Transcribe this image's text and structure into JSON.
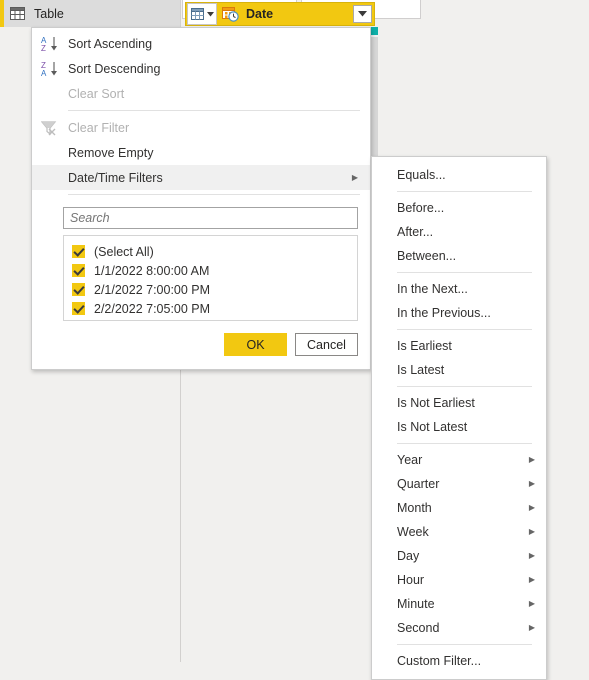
{
  "workspace": {
    "table_tab_label": "Table",
    "accent_color": "#f2c811",
    "background_color": "#f1f0ee",
    "quality_bar_color": "#0fb0a9"
  },
  "column_header": {
    "name": "Date",
    "type_icon": "datetime-icon",
    "table_icon": "table-icon",
    "dropdown_icon": "chevron-down-icon",
    "background_color": "#f2c811"
  },
  "context_menu": {
    "items": [
      {
        "label": "Sort Ascending",
        "icon": "sort-ascending-icon",
        "disabled": false,
        "submenu": false,
        "highlighted": false
      },
      {
        "label": "Sort Descending",
        "icon": "sort-descending-icon",
        "disabled": false,
        "submenu": false,
        "highlighted": false
      },
      {
        "label": "Clear Sort",
        "icon": "",
        "disabled": true,
        "submenu": false,
        "highlighted": false
      },
      {
        "label": "Clear Filter",
        "icon": "clear-filter-icon",
        "disabled": true,
        "submenu": false,
        "highlighted": false
      },
      {
        "label": "Remove Empty",
        "icon": "",
        "disabled": false,
        "submenu": false,
        "highlighted": false
      },
      {
        "label": "Date/Time Filters",
        "icon": "",
        "disabled": false,
        "submenu": true,
        "highlighted": true
      }
    ],
    "search": {
      "placeholder": "Search",
      "value": ""
    },
    "values": [
      {
        "label": "(Select All)",
        "checked": true
      },
      {
        "label": "1/1/2022 8:00:00 AM",
        "checked": true
      },
      {
        "label": "2/1/2022 7:00:00 PM",
        "checked": true
      },
      {
        "label": "2/2/2022 7:05:00 PM",
        "checked": true
      }
    ],
    "buttons": {
      "ok": "OK",
      "cancel": "Cancel"
    }
  },
  "submenu": {
    "items": [
      {
        "label": "Equals...",
        "submenu": false,
        "sep_after": true
      },
      {
        "label": "Before...",
        "submenu": false,
        "sep_after": false
      },
      {
        "label": "After...",
        "submenu": false,
        "sep_after": false
      },
      {
        "label": "Between...",
        "submenu": false,
        "sep_after": true
      },
      {
        "label": "In the Next...",
        "submenu": false,
        "sep_after": false
      },
      {
        "label": "In the Previous...",
        "submenu": false,
        "sep_after": true
      },
      {
        "label": "Is Earliest",
        "submenu": false,
        "sep_after": false
      },
      {
        "label": "Is Latest",
        "submenu": false,
        "sep_after": true
      },
      {
        "label": "Is Not Earliest",
        "submenu": false,
        "sep_after": false
      },
      {
        "label": "Is Not Latest",
        "submenu": false,
        "sep_after": true
      },
      {
        "label": "Year",
        "submenu": true,
        "sep_after": false
      },
      {
        "label": "Quarter",
        "submenu": true,
        "sep_after": false
      },
      {
        "label": "Month",
        "submenu": true,
        "sep_after": false
      },
      {
        "label": "Week",
        "submenu": true,
        "sep_after": false
      },
      {
        "label": "Day",
        "submenu": true,
        "sep_after": false
      },
      {
        "label": "Hour",
        "submenu": true,
        "sep_after": false
      },
      {
        "label": "Minute",
        "submenu": true,
        "sep_after": false
      },
      {
        "label": "Second",
        "submenu": true,
        "sep_after": true
      },
      {
        "label": "Custom Filter...",
        "submenu": false,
        "sep_after": false
      }
    ]
  }
}
